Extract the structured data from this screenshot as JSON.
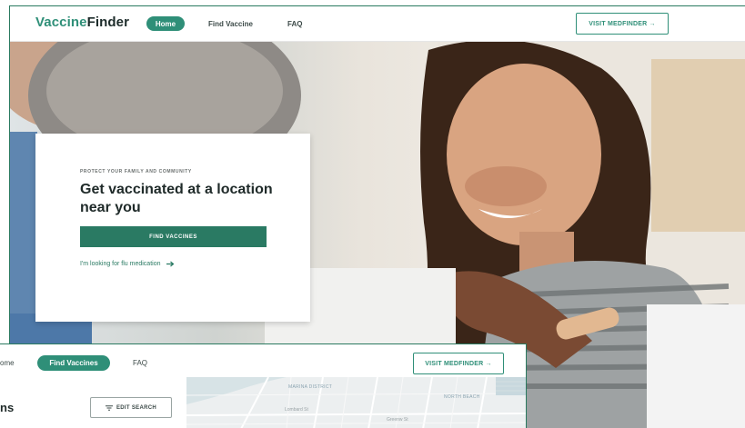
{
  "main_window": {
    "logo": {
      "part_a": "Vaccine",
      "part_b": "Finder"
    },
    "nav": {
      "home": "Home",
      "find_vaccine": "Find Vaccine",
      "faq": "FAQ",
      "visit": "VISIT MEDFINDER →"
    },
    "hero": {
      "eyebrow": "PROTECT YOUR FAMILY AND COMMUNITY",
      "headline": "Get vaccinated at a location near you",
      "cta": "FIND VACCINES",
      "link": "I'm looking for flu medication",
      "link_icon": "arrow-right-icon"
    }
  },
  "second_window": {
    "nav": {
      "home_partial": "ome",
      "find_vaccines": "Find Vaccines",
      "faq": "FAQ",
      "visit": "VISIT MEDFINDER →"
    },
    "title_partial": "ns",
    "edit_search": "EDIT SEARCH",
    "edit_icon": "filter-icon",
    "map": {
      "labels": [
        "MARINA DISTRICT",
        "Lombard St",
        "NORTH BEACH",
        "Greenw St"
      ]
    }
  },
  "colors": {
    "brand": "#2f8f78",
    "brand_dark": "#2a7a63",
    "text_dark": "#1f2a29",
    "window_border": "#2a7a60"
  }
}
